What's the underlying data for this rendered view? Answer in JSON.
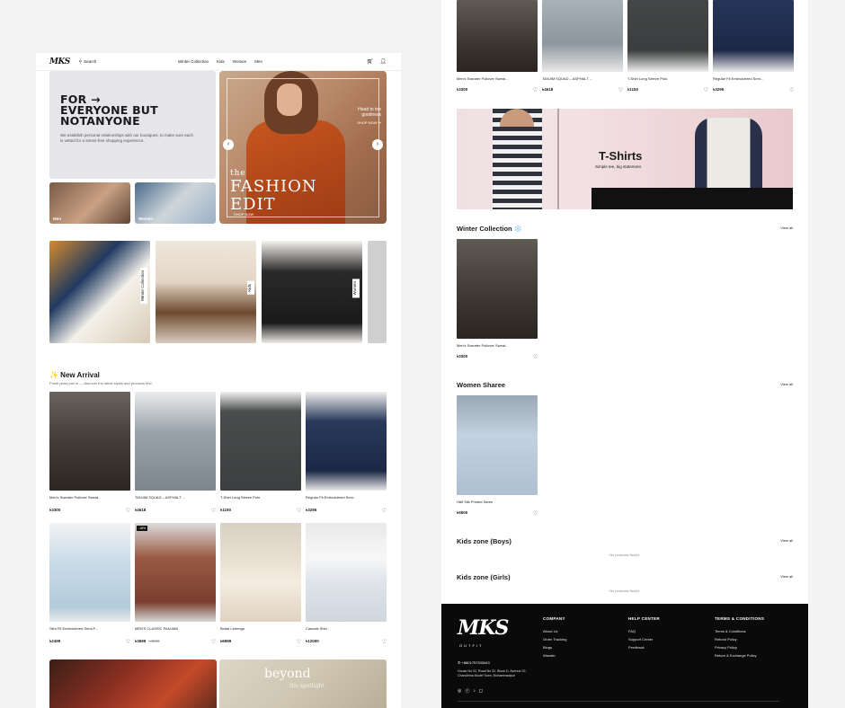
{
  "header": {
    "logo": "MKS",
    "search_label": "Search",
    "nav": [
      "Winter Collection",
      "Kids",
      "Women",
      "Men"
    ]
  },
  "hero": {
    "heading_line1": "FOR →",
    "heading_line2": "EVERYONE BUT",
    "heading_line3": "NOTANYONE",
    "paragraph": "We establish personal relationships with our boutiques, to make sure each is vetted for a stress-free shopping experience.",
    "banner_small": "the",
    "banner_title1": "FASHION",
    "banner_title2": "EDIT",
    "banner_side_text1": "Head to toe",
    "banner_side_text2": "goodness",
    "banner_side_cta": "SHOP NOW ➔",
    "banner_cta": "SHOP NOW"
  },
  "category_tiles": [
    {
      "label": "Men"
    },
    {
      "label": "Women"
    }
  ],
  "strip": [
    {
      "label": "Winter Collection"
    },
    {
      "label": "Kids"
    },
    {
      "label": "Women"
    }
  ],
  "new_arrival": {
    "title": "✨ New Arrival",
    "subtitle": "Fresh picks just in — discover the latest styles and products first.",
    "products": [
      {
        "name": "Men's Sweater Pullover Sweat...",
        "price": "৳3300",
        "old": ""
      },
      {
        "name": "TANJIM SQUAD – ASPHALT ...",
        "price": "৳4618",
        "old": ""
      },
      {
        "name": "T-Shirt Long Sleeve Polo",
        "price": "৳1150",
        "old": ""
      },
      {
        "name": "Regular Fit Embroidered Sem...",
        "price": "৳3295",
        "old": ""
      },
      {
        "name": "Slim Fit Embroidered Semi-F...",
        "price": "৳2499",
        "old": ""
      },
      {
        "name": "MEN'S CLASSIC PANJABI",
        "price": "৳3699",
        "old": "৳4500"
      },
      {
        "name": "Bridal Lehenga",
        "price": "৳6999",
        "old": ""
      },
      {
        "name": "Casuals Shirt",
        "price": "৳12000",
        "old": ""
      }
    ],
    "badge": "-18%"
  },
  "bottom_banners": {
    "right_title": "beyond",
    "right_sub": "the spotlight"
  },
  "right_top_products": [
    {
      "name": "Men's Sweater Pullover Sweat...",
      "price": "৳3300"
    },
    {
      "name": "TANJIM SQUAD – ASPHALT ...",
      "price": "৳4618"
    },
    {
      "name": "T-Shirt Long Sleeve Polo",
      "price": "৳1150"
    },
    {
      "name": "Regular Fit Embroidered Sem...",
      "price": "৳3295"
    }
  ],
  "tshirt_banner": {
    "title": "T-Shirts",
    "subtitle": "Simple tee, big statement."
  },
  "winter": {
    "title": "Winter Collection ❄️",
    "view_all": "View all",
    "product": {
      "name": "Men's Sweater Pullover Sweat...",
      "price": "৳3300"
    }
  },
  "sharee": {
    "title": "Women Sharee",
    "view_all": "View all",
    "product": {
      "name": "Half Silk Printed Saree",
      "price": "৳5500"
    }
  },
  "kids_boys": {
    "title": "Kids zone (Boys)",
    "view_all": "View all",
    "empty": "No products found."
  },
  "kids_girls": {
    "title": "Kids zone (Girls)",
    "view_all": "View all",
    "empty": "No products found."
  },
  "footer": {
    "logo": "MKS",
    "outfit": "OUTFIT",
    "phone": "+8801757333443",
    "address": "House No 02, Road No 32, Block D, Avenue 02, Chandrima Model Town, Mohammadpur",
    "company": {
      "title": "COMPANY",
      "links": [
        "About Us",
        "Order Tracking",
        "Blogs",
        "Wander"
      ]
    },
    "help": {
      "title": "HELP CENTER",
      "links": [
        "FAQ",
        "Support Center",
        "Feedback"
      ]
    },
    "terms": {
      "title": "TERMS & CONDITIONS",
      "links": [
        "Terms & Conditions",
        "Refund Policy",
        "Privacy Policy",
        "Return & Exchange Policy"
      ]
    }
  },
  "colors": {
    "footer_bg": "#0a0a0a",
    "hero_bg": "#e6e6ea",
    "accent": "#c7561f"
  }
}
